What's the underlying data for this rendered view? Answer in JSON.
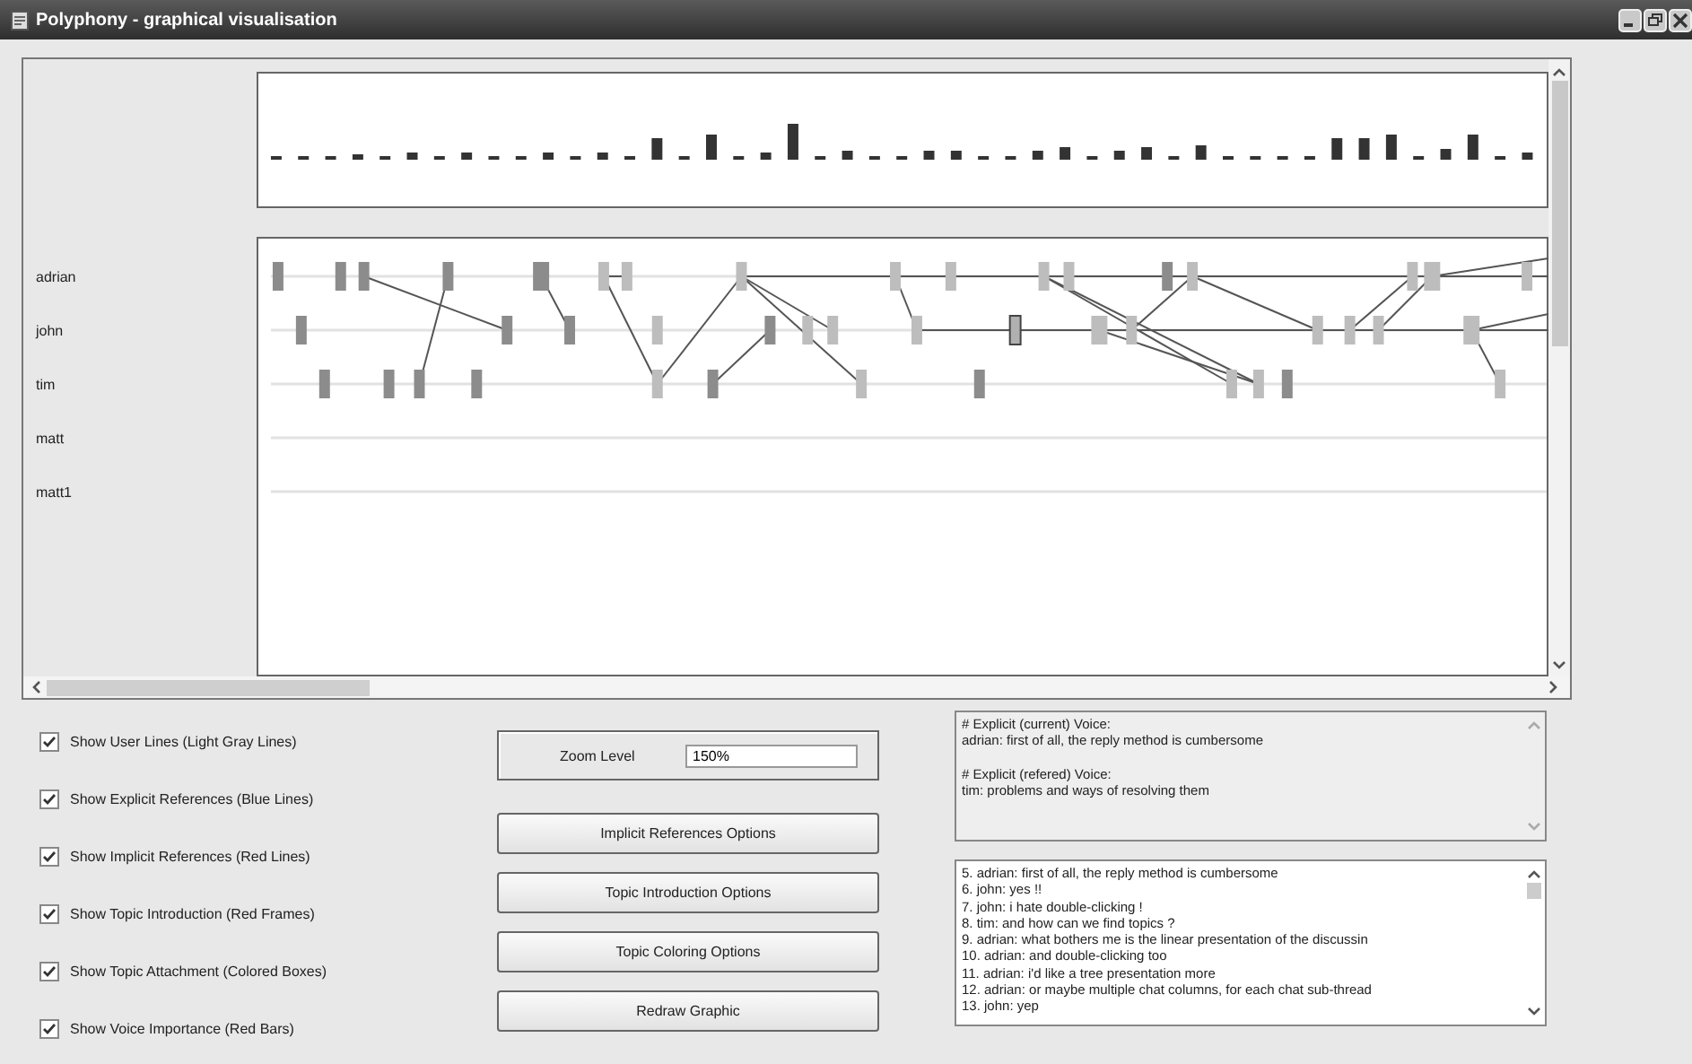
{
  "window": {
    "title": "Polyphony - graphical visualisation"
  },
  "users": [
    {
      "name": "adrian"
    },
    {
      "name": "john"
    },
    {
      "name": "tim"
    },
    {
      "name": "matt"
    },
    {
      "name": "matt1"
    }
  ],
  "options": [
    {
      "label": "Show User Lines (Light Gray Lines)",
      "checked": true
    },
    {
      "label": "Show Explicit References (Blue Lines)",
      "checked": true
    },
    {
      "label": "Show Implicit References (Red Lines)",
      "checked": true
    },
    {
      "label": "Show Topic Introduction (Red Frames)",
      "checked": true
    },
    {
      "label": "Show Topic Attachment (Colored Boxes)",
      "checked": true
    },
    {
      "label": "Show Voice Importance (Red Bars)",
      "checked": true
    }
  ],
  "zoom": {
    "label": "Zoom Level",
    "value": "150%"
  },
  "buttons": [
    "Implicit References Options",
    "Topic Introduction Options",
    "Topic Coloring Options",
    "Redraw Graphic"
  ],
  "voices": [
    {
      "heading": "# Explicit (current) Voice:",
      "text": "adrian: first of all, the reply method is cumbersome"
    },
    {
      "heading": "# Explicit (refered) Voice:",
      "text": "tim: problems and ways of resolving them"
    }
  ],
  "chat": [
    "5. adrian: first of all, the reply method is cumbersome",
    "6. john: yes !!",
    "7. john: i hate double-clicking !",
    "8. tim: and how can we find topics ?",
    "9. adrian: what bothers me is the linear presentation of the discussin",
    "10. adrian: and double-clicking too",
    "11. adrian: i'd like a tree presentation more",
    "12. adrian: or maybe multiple chat columns, for each chat sub-thread",
    "13. john: yep"
  ]
}
